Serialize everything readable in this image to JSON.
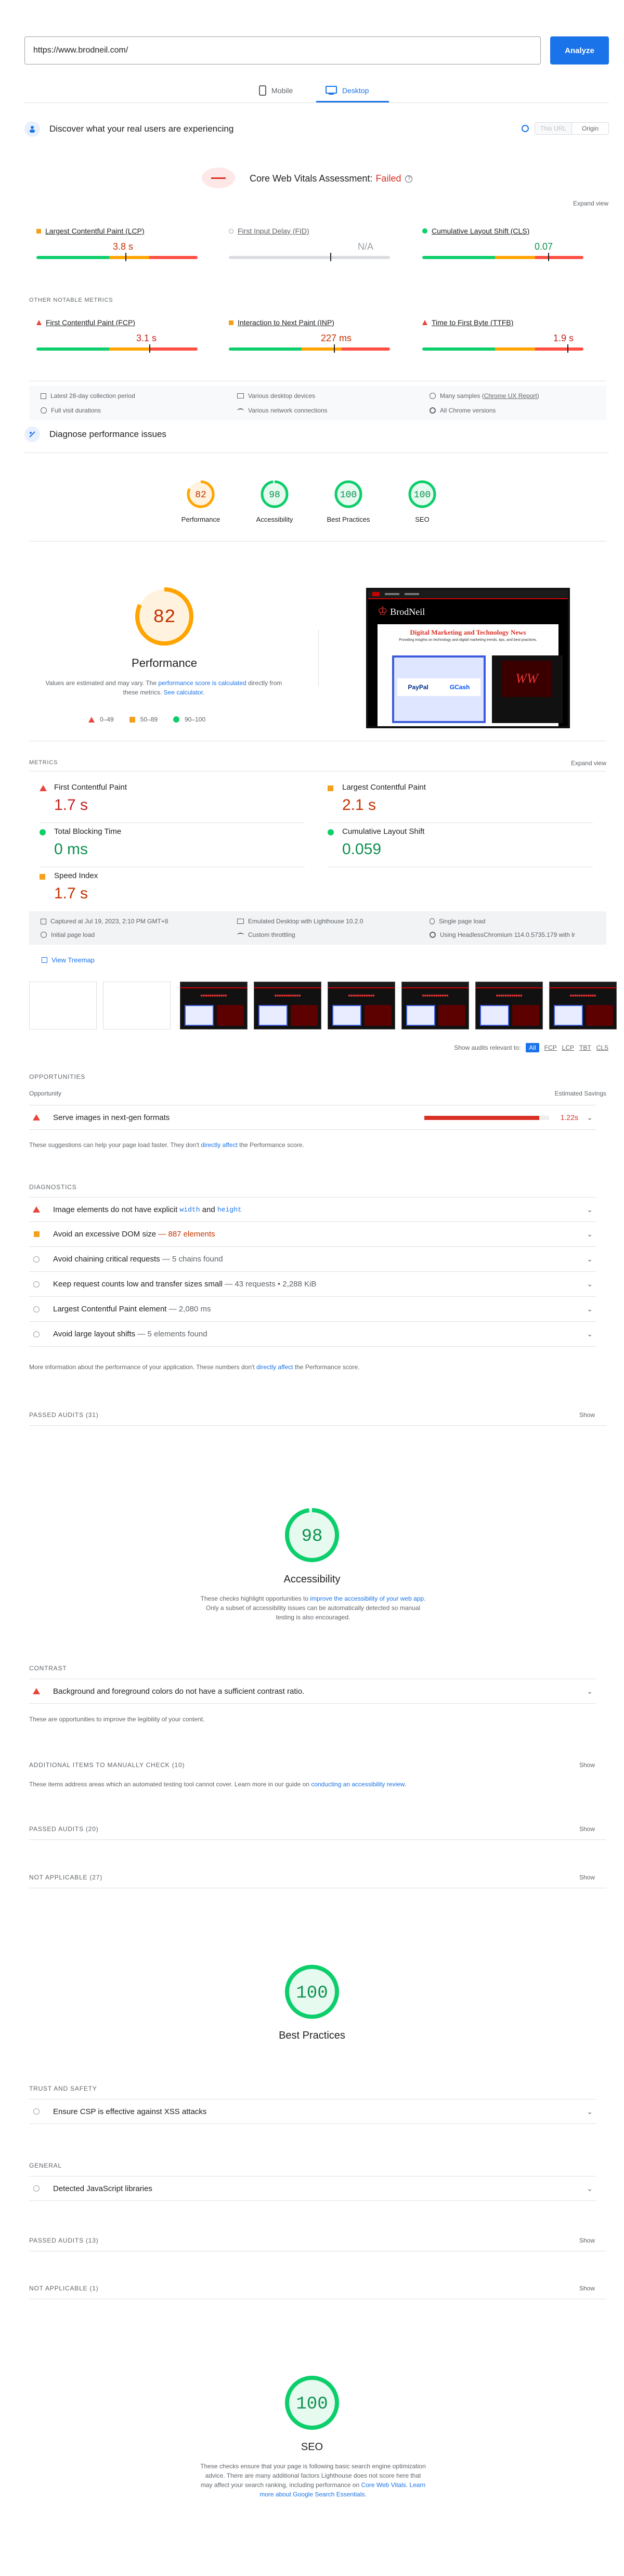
{
  "search": {
    "url": "https://www.brodneil.com/",
    "analyze": "Analyze"
  },
  "device_tabs": {
    "mobile": "Mobile",
    "desktop": "Desktop"
  },
  "cwv_banner": {
    "title": "Discover what your real users are experiencing",
    "toggle_this_url": "This URL",
    "toggle_origin": "Origin"
  },
  "cwv": {
    "label": "Core Web Vitals Assessment:",
    "status": "Failed",
    "expand": "Expand view",
    "metrics": [
      {
        "name": "Largest Contentful Paint (LCP)",
        "value": "3.8 s",
        "marker": 0.55
      },
      {
        "name": "First Input Delay (FID)",
        "value": "N/A"
      },
      {
        "name": "Cumulative Layout Shift (CLS)",
        "value": "0.07",
        "marker": 0.78
      }
    ]
  },
  "other_metrics": {
    "heading": "OTHER NOTABLE METRICS",
    "metrics": [
      {
        "name": "First Contentful Paint (FCP)",
        "value": "3.1 s",
        "marker": 0.7
      },
      {
        "name": "Interaction to Next Paint (INP)",
        "value": "227 ms",
        "marker": 0.65
      },
      {
        "name": "Time to First Byte (TTFB)",
        "value": "1.9 s",
        "marker": 0.9
      }
    ]
  },
  "field_info": [
    "Latest 28-day collection period",
    "Various desktop devices",
    "Many samples",
    "Chrome UX Report",
    "Full visit durations",
    "Various network connections",
    "All Chrome versions"
  ],
  "diagnose": {
    "title": "Diagnose performance issues"
  },
  "score_gauges": [
    {
      "score": "82",
      "label": "Performance",
      "color": "#ffa400",
      "value": 82
    },
    {
      "score": "98",
      "label": "Accessibility",
      "color": "#0cce6b",
      "value": 98
    },
    {
      "score": "100",
      "label": "Best Practices",
      "color": "#0cce6b",
      "value": 100
    },
    {
      "score": "100",
      "label": "SEO",
      "color": "#0cce6b",
      "value": 100
    }
  ],
  "performance": {
    "score": "82",
    "title": "Performance",
    "desc1": "Values are estimated and may vary. The ",
    "desc_link": "performance score is calculated",
    "desc2": " directly from these metrics. ",
    "calc_link": "See calculator.",
    "legend": [
      "0–49",
      "50–89",
      "90–100"
    ]
  },
  "preview": {
    "site_title": "Digital Marketing and Technology News",
    "site_sub": "Providing insights on technology and digital marketing trends, tips, and best practices.",
    "paypal": "PayPal",
    "gcash": "GCash",
    "logo": "BrodNeil"
  },
  "metrics": {
    "heading": "METRICS",
    "expand": "Expand view",
    "items": [
      {
        "name": "First Contentful Paint",
        "value": "1.7 s"
      },
      {
        "name": "Largest Contentful Paint",
        "value": "2.1 s"
      },
      {
        "name": "Total Blocking Time",
        "value": "0 ms"
      },
      {
        "name": "Cumulative Layout Shift",
        "value": "0.059"
      },
      {
        "name": "Speed Index",
        "value": "1.7 s"
      }
    ]
  },
  "lab_info": [
    "Captured at Jul 19, 2023, 2:10 PM GMT+8",
    "Emulated Desktop with Lighthouse 10.2.0",
    "Single page load",
    "Initial page load",
    "Custom throttling",
    "Using HeadlessChromium 114.0.5735.179 with lr"
  ],
  "treemap": "View Treemap",
  "filters": {
    "label": "Show audits relevant to:",
    "all": "All",
    "fcp": "FCP",
    "lcp": "LCP",
    "tbt": "TBT",
    "cls": "CLS"
  },
  "opportunities": {
    "heading": "OPPORTUNITIES",
    "col1": "Opportunity",
    "col2": "Estimated Savings",
    "item": "Serve images in next-gen formats",
    "savings": "1.22s",
    "note1": "These suggestions can help your page load faster. They don't ",
    "note_link": "directly affect",
    "note2": " the Performance score."
  },
  "diagnostics": {
    "heading": "DIAGNOSTICS",
    "items": [
      {
        "t": "Image elements do not have explicit ",
        "c1": "width",
        "m": " and ",
        "c2": "height",
        "type": "fail"
      },
      {
        "t": "Avoid an excessive DOM size",
        "d": " — 887 elements",
        "type": "avg"
      },
      {
        "t": "Avoid chaining critical requests",
        "d": " — 5 chains found",
        "type": "info"
      },
      {
        "t": "Keep request counts low and transfer sizes small",
        "d": " — 43 requests • 2,288 KiB",
        "type": "info"
      },
      {
        "t": "Largest Contentful Paint element",
        "d": " — 2,080 ms",
        "type": "info"
      },
      {
        "t": "Avoid large layout shifts",
        "d": " — 5 elements found",
        "type": "info"
      }
    ],
    "note1": "More information about the performance of your application. These numbers don't ",
    "note_link": "directly affect",
    "note2": " the Performance score."
  },
  "passed_perf": {
    "label": "PASSED AUDITS (31)",
    "show": "Show"
  },
  "accessibility": {
    "score": "98",
    "title": "Accessibility",
    "d1": "These checks highlight opportunities to ",
    "link": "improve the accessibility of your web app",
    "d2": ". Only a subset of accessibility issues can be automatically detected so manual testing is also encouraged.",
    "contrast_heading": "CONTRAST",
    "contrast_item": "Background and foreground colors do not have a sufficient contrast ratio.",
    "contrast_note": "These are opportunities to improve the legibility of your content.",
    "manual": "ADDITIONAL ITEMS TO MANUALLY CHECK (10)",
    "manual_note1": "These items address areas which an automated testing tool cannot cover. Learn more in our guide on ",
    "manual_link": "conducting an accessibility review",
    "manual_note2": ".",
    "passed": "PASSED AUDITS (20)",
    "na": "NOT APPLICABLE (27)",
    "show": "Show"
  },
  "best_practices": {
    "score": "100",
    "title": "Best Practices",
    "trust": "TRUST AND SAFETY",
    "trust_item": "Ensure CSP is effective against XSS attacks",
    "general": "GENERAL",
    "general_item": "Detected JavaScript libraries",
    "passed": "PASSED AUDITS (13)",
    "na": "NOT APPLICABLE (1)",
    "show": "Show"
  },
  "seo": {
    "score": "100",
    "title": "SEO",
    "d1": "These checks ensure that your page is following basic search engine optimization advice. There are many additional factors Lighthouse does not score here that may affect your search ranking, including performance on ",
    "link1": "Core Web Vitals",
    "d2": ". ",
    "link2": "Learn more about Google Search Essentials",
    "d3": "."
  },
  "colors": {
    "accent": "#1a73e8",
    "good": "#0cce6b",
    "average": "#ffa400",
    "poor": "#ff4e42"
  }
}
